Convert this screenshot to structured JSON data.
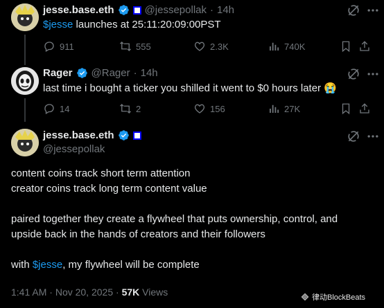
{
  "tweets": [
    {
      "display_name": "jesse.base.eth",
      "handle": "@jessepollak",
      "dot": "·",
      "time": "14h",
      "text_cashtag": "$jesse",
      "text_rest": " launches at 25:11:20:09:00PST",
      "replies": "911",
      "reposts": "555",
      "likes": "2.3K",
      "views": "740K"
    },
    {
      "display_name": "Rager",
      "handle": "@Rager",
      "dot": "·",
      "time": "14h",
      "text": "last time i bought a ticker you shilled it went to $0 hours later 😭",
      "replies": "14",
      "reposts": "2",
      "likes": "156",
      "views": "27K"
    }
  ],
  "main_tweet": {
    "display_name": "jesse.base.eth",
    "handle": "@jessepollak",
    "line1": "content coins track short term attention",
    "line2": "creator coins track long term content value",
    "line3": "paired together they create a flywheel that puts ownership, control, and",
    "line4": "upside back in the hands of creators and their followers",
    "line5_prefix": "with ",
    "line5_cashtag": "$jesse",
    "line5_suffix": ", my flywheel will be complete",
    "time": "1:41 AM",
    "dot": "·",
    "date": "Nov 20, 2025",
    "dot2": "·",
    "views_count": "57K",
    "views_label": "Views"
  },
  "watermark": {
    "text": "律动BlockBeats"
  },
  "colors": {
    "accent": "#1d9bf0",
    "muted": "#71767b",
    "text": "#e7e9ea",
    "background": "#000000"
  }
}
